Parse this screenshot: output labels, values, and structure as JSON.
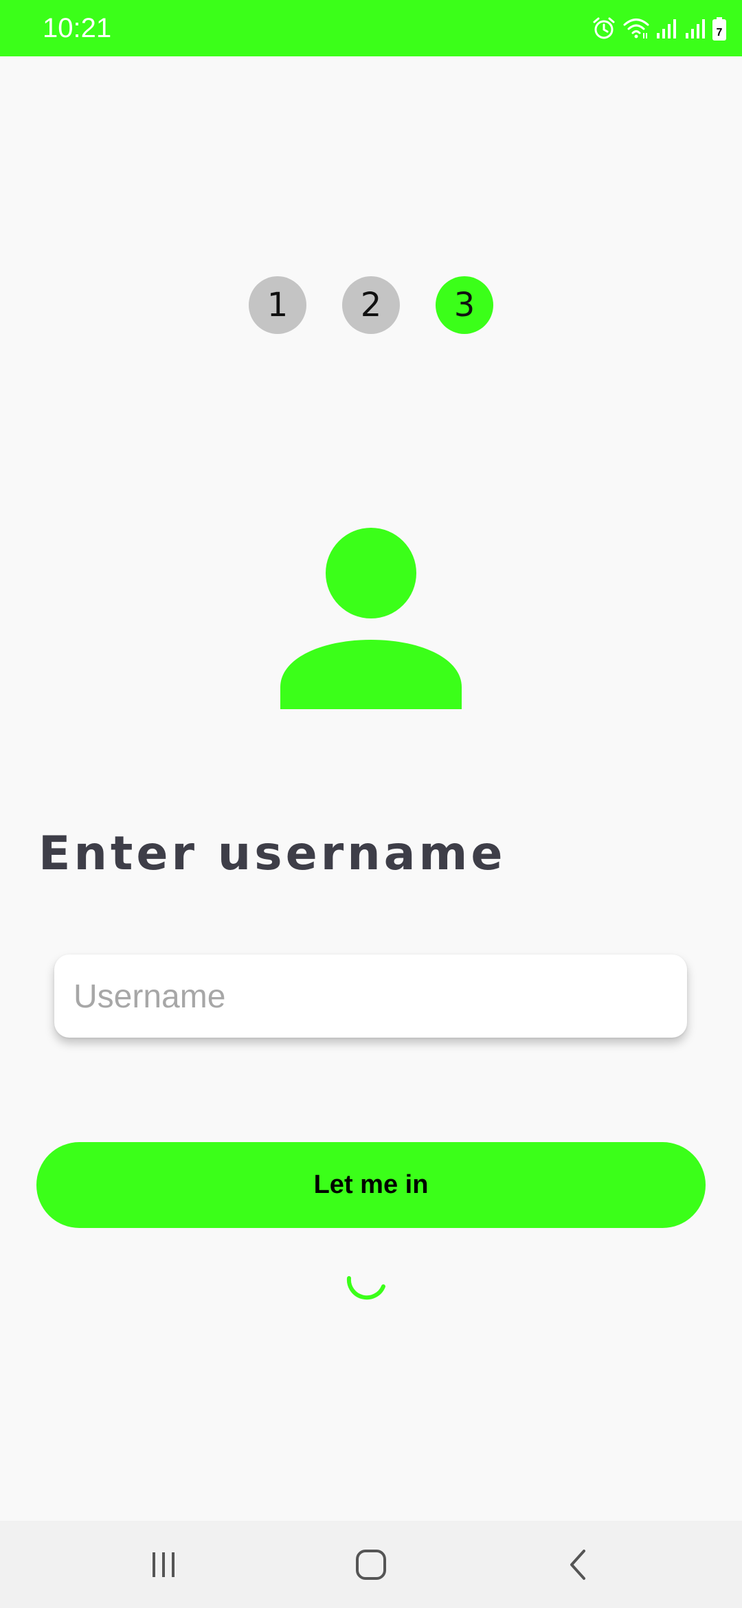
{
  "status_bar": {
    "time": "10:21",
    "battery_level": "7",
    "icons": [
      "alarm-icon",
      "wifi-icon",
      "signal-icon",
      "signal-icon",
      "battery-icon"
    ]
  },
  "steps": {
    "items": [
      {
        "label": "1",
        "active": false
      },
      {
        "label": "2",
        "active": false
      },
      {
        "label": "3",
        "active": true
      }
    ]
  },
  "avatar": {
    "icon": "user-icon"
  },
  "heading": "Enter username",
  "username_input": {
    "placeholder": "Username",
    "value": ""
  },
  "login_button": {
    "label": "Let me in"
  },
  "loading": {
    "icon": "spinner-icon"
  },
  "nav_bar": {
    "icons": [
      "recent-apps-icon",
      "home-icon",
      "back-icon"
    ]
  },
  "colors": {
    "accent": "#3bff19",
    "inactive_step": "#c4c4c4",
    "heading_text": "#3e3e48",
    "background": "#f9f9f9"
  }
}
